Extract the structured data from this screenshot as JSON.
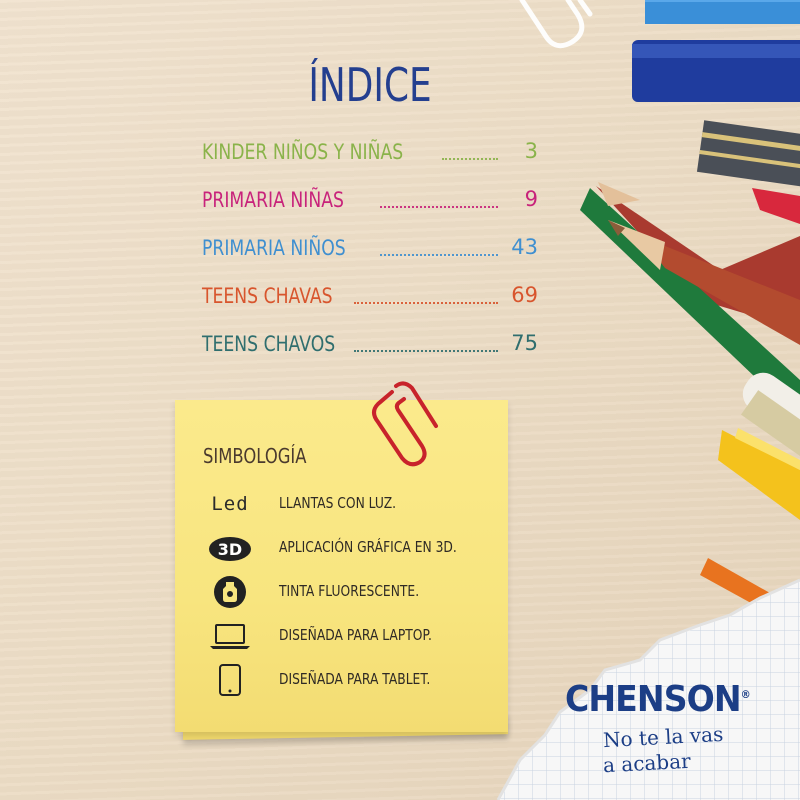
{
  "index": {
    "title": "ÍNDICE",
    "entries": [
      {
        "label": "KINDER NIÑOS Y NIÑAS",
        "page": "3",
        "color": "#8ab34a"
      },
      {
        "label": "PRIMARIA NIÑAS",
        "page": "9",
        "color": "#c8237b"
      },
      {
        "label": "PRIMARIA NIÑOS",
        "page": "43",
        "color": "#3f8fd0"
      },
      {
        "label": "TEENS CHAVAS",
        "page": "69",
        "color": "#d8552d"
      },
      {
        "label": "TEENS CHAVOS",
        "page": "75",
        "color": "#2f6e6e"
      }
    ]
  },
  "legend": {
    "title": "SIMBOLOGÍA",
    "items": [
      {
        "icon": "led-text-icon",
        "icon_text": "Led",
        "label": "LLANTAS CON LUZ."
      },
      {
        "icon": "3d-badge-icon",
        "icon_text": "3D",
        "label": "APLICACIÓN GRÁFICA EN 3D."
      },
      {
        "icon": "fluorescent-ink-icon",
        "label": "TINTA FLUORESCENTE."
      },
      {
        "icon": "laptop-icon",
        "label": "DISEÑADA PARA LAPTOP."
      },
      {
        "icon": "tablet-icon",
        "label": "DISEÑADA PARA TABLET."
      }
    ]
  },
  "brand": {
    "name": "CHENSON",
    "registered": "®",
    "tagline_line1": "No te la vas",
    "tagline_line2": "a acabar",
    "color": "#1c3e86"
  },
  "colors": {
    "title": "#243f8f",
    "note": "#f8e57f"
  }
}
